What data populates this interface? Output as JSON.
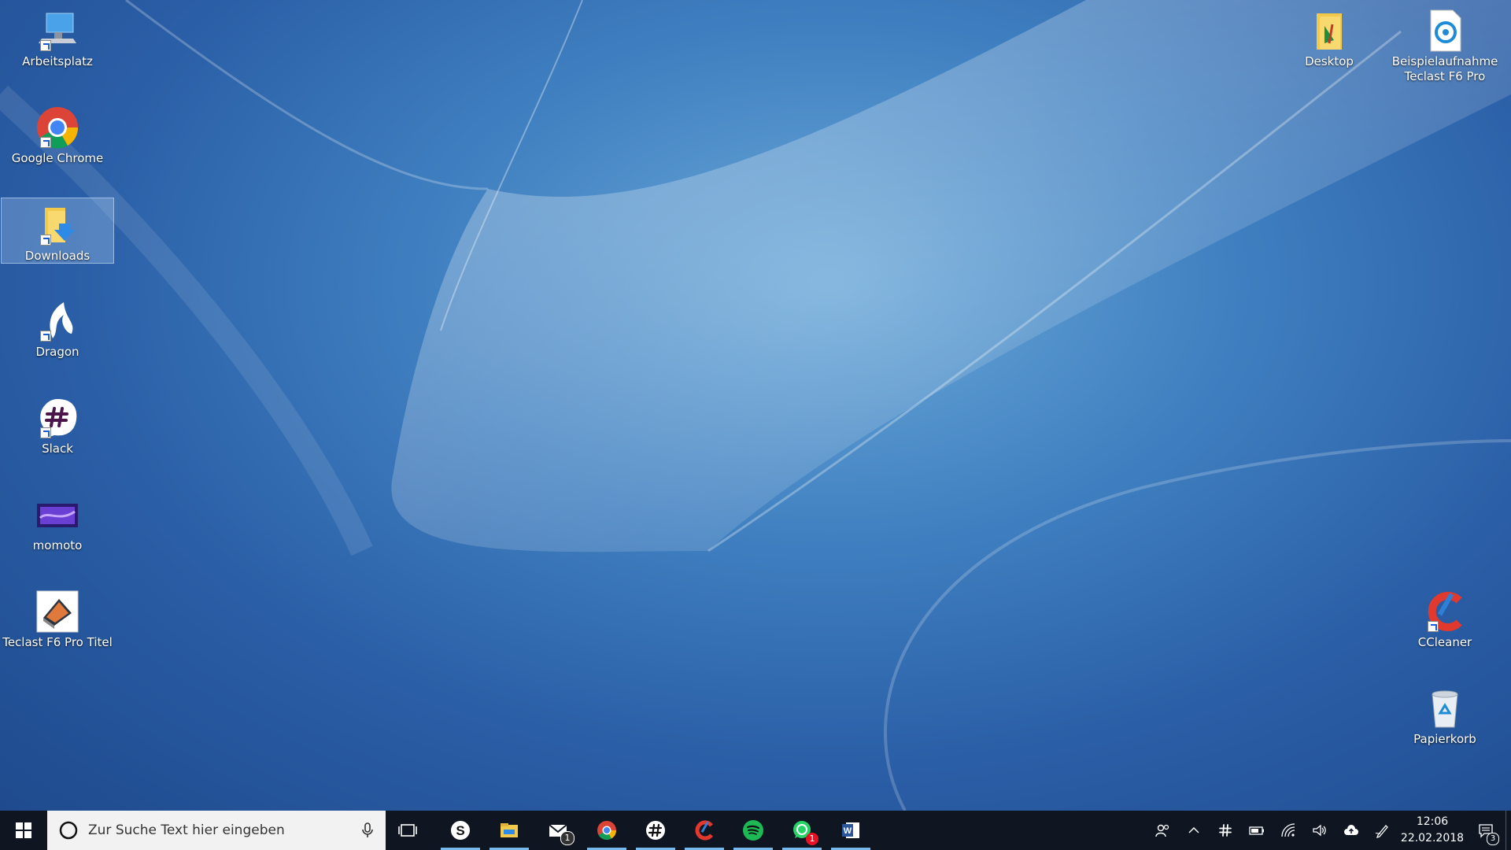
{
  "desktop": {
    "left_icons": [
      {
        "label": "Arbeitsplatz",
        "icon": "computer-icon"
      },
      {
        "label": "Google Chrome",
        "icon": "chrome-icon"
      },
      {
        "label": "Downloads",
        "icon": "downloads-folder-icon",
        "selected": true
      },
      {
        "label": "Dragon",
        "icon": "dragon-icon"
      },
      {
        "label": "Slack",
        "icon": "slack-icon"
      },
      {
        "label": "momoto",
        "icon": "image-file-icon"
      },
      {
        "label": "Teclast F6 Pro Titel",
        "icon": "image-file-icon"
      }
    ],
    "right_icons": [
      {
        "label": "Desktop",
        "icon": "folder-icon"
      },
      {
        "label": "Beispielaufnahme Teclast F6 Pro",
        "line1": "Beispielaufnahme",
        "line2": "Teclast F6 Pro",
        "icon": "audio-file-icon"
      },
      {
        "label": "CCleaner",
        "icon": "ccleaner-icon"
      },
      {
        "label": "Papierkorb",
        "icon": "recycle-bin-icon"
      }
    ]
  },
  "taskbar": {
    "search_placeholder": "Zur Suche Text hier eingeben",
    "apps": [
      {
        "name": "skype",
        "running": true
      },
      {
        "name": "file-explorer",
        "running": true
      },
      {
        "name": "mail",
        "running": false,
        "badge": "1"
      },
      {
        "name": "chrome",
        "running": true
      },
      {
        "name": "slack",
        "running": true
      },
      {
        "name": "ccleaner",
        "running": true
      },
      {
        "name": "spotify",
        "running": true
      },
      {
        "name": "whatsapp",
        "running": true,
        "badge": "1"
      },
      {
        "name": "word",
        "running": true
      }
    ],
    "clock": {
      "time": "12:06",
      "date": "22.02.2018"
    },
    "notification_count": "3"
  },
  "colors": {
    "taskbar": "#0f1622",
    "running_indicator": "#76b9ed",
    "selection": "#add1f5"
  }
}
